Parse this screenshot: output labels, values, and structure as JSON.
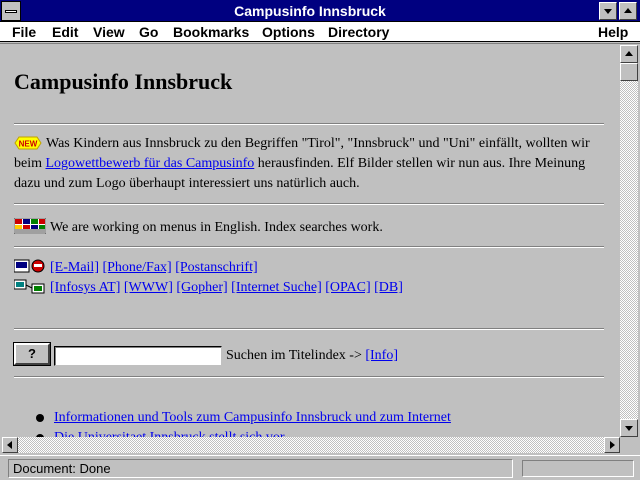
{
  "window": {
    "title": "Campusinfo Innsbruck"
  },
  "menu": {
    "file": "File",
    "edit": "Edit",
    "view": "View",
    "go": "Go",
    "bookmarks": "Bookmarks",
    "options": "Options",
    "directory": "Directory",
    "help": "Help"
  },
  "page": {
    "heading": "Campusinfo Innsbruck",
    "new_badge": "NEW",
    "intro_text_1": "Was Kindern aus Innsbruck zu den Begriffen \"Tirol\", \"Innsbruck\" und \"Uni\" einfällt, wollten wir beim ",
    "intro_link": "Logowettbewerb für das Campusinfo",
    "intro_text_2": " herausfinden. Elf Bilder stellen wir nun aus. Ihre Meinung dazu und zum Logo überhaupt interessiert uns natürlich auch.",
    "english_note": "We are working on menus in English. Index searches work.",
    "contact_links": [
      "[E-Mail]",
      "[Phone/Fax]",
      "[Postanschrift]"
    ],
    "info_links": [
      "[Infosys AT]",
      "[WWW]",
      "[Gopher]",
      "[Internet Suche]",
      "[OPAC]",
      "[DB]"
    ],
    "search_button": "?",
    "search_value": "",
    "search_label": "Suchen im Titelindex ->",
    "search_info_link": "[Info]",
    "list_items": [
      "Informationen und Tools zum Campusinfo Innsbruck und zum Internet",
      "Die Universitaet Innsbruck stellt sich vor"
    ]
  },
  "status": {
    "text": "Document: Done"
  }
}
